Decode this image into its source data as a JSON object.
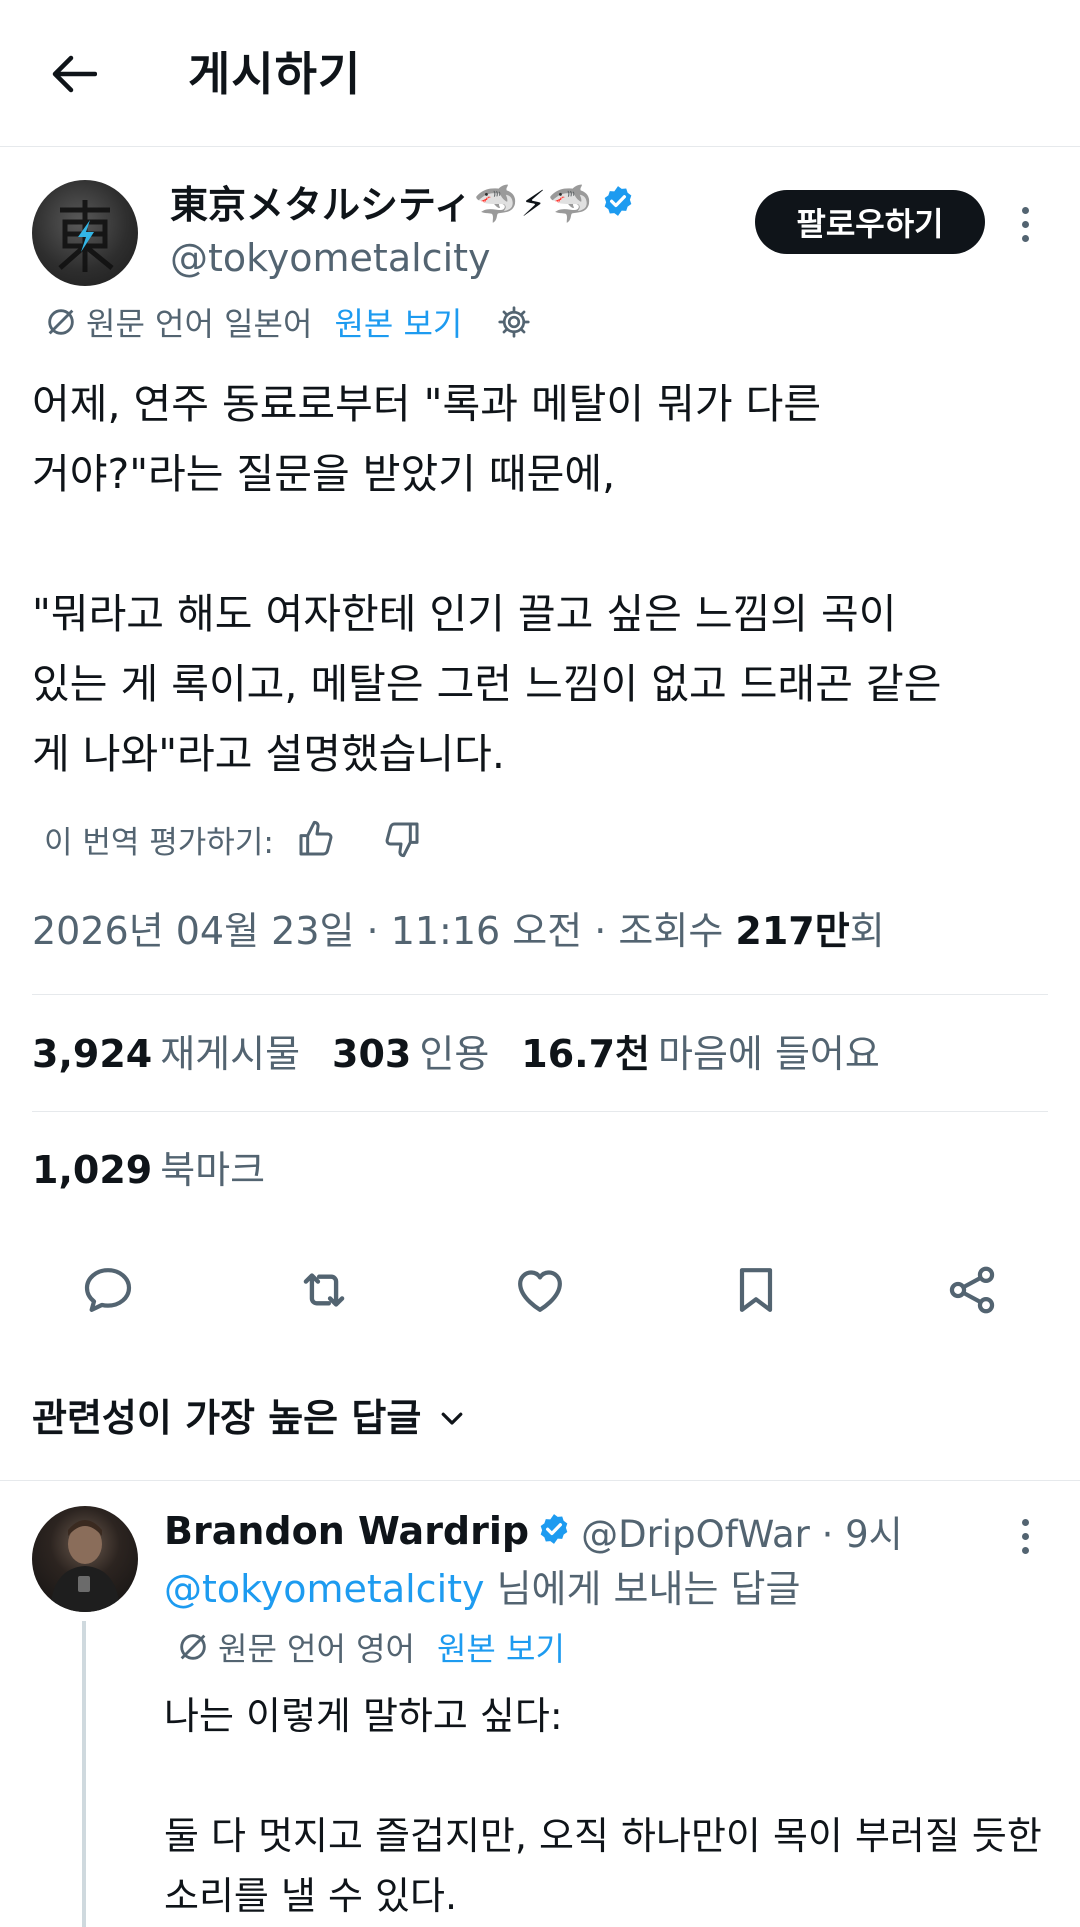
{
  "header": {
    "title": "게시하기",
    "back_icon": "arrow-left-icon"
  },
  "tweet": {
    "display_name": "東京メタルシティ",
    "name_emojis": [
      "🦈",
      "⚡",
      "🦈"
    ],
    "handle": "@tokyometalcity",
    "follow_label": "팔로우하기",
    "translation": {
      "source_lang": "원문 언어 일본어",
      "show_original": "원본 보기"
    },
    "text": "어제, 연주 동료로부터 \"록과 메탈이 뭐가 다른\n거야?\"라는 질문을 받았기 때문에,\n\n\"뭐라고 해도 여자한테 인기 끌고 싶은 느낌의 곡이\n있는 게 록이고, 메탈은 그런 느낌이 없고 드래곤 같은\n게 나와\"라고 설명했습니다.",
    "rate_translation": "이 번역 평가하기:",
    "meta": {
      "date_time": "2026년 04월 23일 · 11:16 오전 · 조회수 ",
      "views_number": "217만",
      "views_suffix": "회"
    },
    "stats": {
      "reposts_num": "3,924",
      "reposts_label": "재게시물",
      "quotes_num": "303",
      "quotes_label": "인용",
      "likes_num": "16.7천",
      "likes_label": "마음에 들어요",
      "bookmarks_num": "1,029",
      "bookmarks_label": "북마크"
    }
  },
  "replies_sort": {
    "label": "관련성이 가장 높은 답글"
  },
  "reply": {
    "name": "Brandon Wardrip",
    "handle_time": "@DripOfWar · 9시",
    "mention": "@tokyometalcity",
    "reply_to_suffix": " 님에게 보내는 답글",
    "translation": {
      "source_lang": "원문 언어 영어",
      "show_original": "원본 보기"
    },
    "text": "나는 이렇게 말하고 싶다:\n\n둘 다 멋지고 즐겁지만, 오직 하나만이 목이 부러질 듯한\n소리를 낼 수 있다."
  },
  "colors": {
    "accent": "#1d9bf0",
    "text": "#0f1419",
    "muted": "#536471",
    "divider": "#e6e9ec"
  }
}
